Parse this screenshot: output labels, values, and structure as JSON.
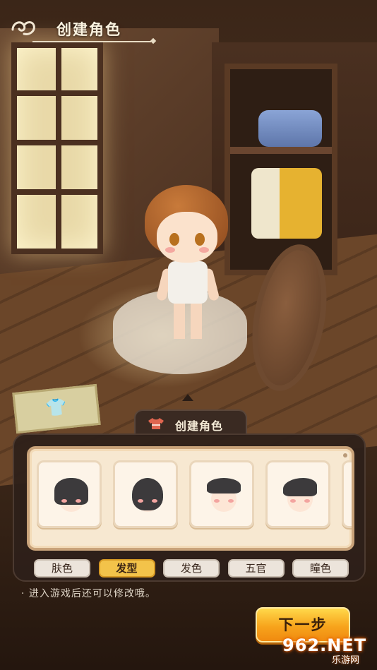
{
  "header": {
    "title": "创建角色",
    "emblem_icon": "swirl-emblem-icon"
  },
  "panel": {
    "tab_title": "创建角色",
    "tab_icon": "shirt-icon",
    "hair_options": [
      {
        "name": "hairstyle-1"
      },
      {
        "name": "hairstyle-2"
      },
      {
        "name": "hairstyle-3"
      },
      {
        "name": "hairstyle-4"
      }
    ],
    "categories": [
      {
        "label": "肤色",
        "active": false
      },
      {
        "label": "发型",
        "active": true
      },
      {
        "label": "发色",
        "active": false
      },
      {
        "label": "五官",
        "active": false
      },
      {
        "label": "瞳色",
        "active": false
      }
    ]
  },
  "hint": "· 进入游戏后还可以修改哦。",
  "next_button": "下一步",
  "watermark": {
    "logo": "962.NET",
    "subtitle": "乐游网"
  },
  "colors": {
    "accent": "#f3c34a",
    "button": "#f7a41c",
    "panel": "#2e201a",
    "card": "#f7e8d1"
  }
}
